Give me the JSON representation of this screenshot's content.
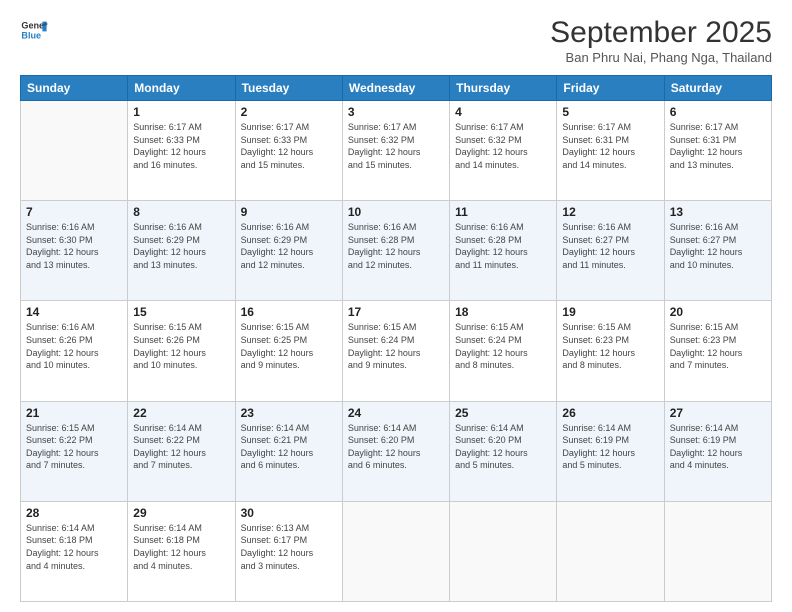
{
  "header": {
    "logo_line1": "General",
    "logo_line2": "Blue",
    "month": "September 2025",
    "location": "Ban Phru Nai, Phang Nga, Thailand"
  },
  "days_of_week": [
    "Sunday",
    "Monday",
    "Tuesday",
    "Wednesday",
    "Thursday",
    "Friday",
    "Saturday"
  ],
  "weeks": [
    [
      {
        "day": "",
        "info": ""
      },
      {
        "day": "1",
        "info": "Sunrise: 6:17 AM\nSunset: 6:33 PM\nDaylight: 12 hours\nand 16 minutes."
      },
      {
        "day": "2",
        "info": "Sunrise: 6:17 AM\nSunset: 6:33 PM\nDaylight: 12 hours\nand 15 minutes."
      },
      {
        "day": "3",
        "info": "Sunrise: 6:17 AM\nSunset: 6:32 PM\nDaylight: 12 hours\nand 15 minutes."
      },
      {
        "day": "4",
        "info": "Sunrise: 6:17 AM\nSunset: 6:32 PM\nDaylight: 12 hours\nand 14 minutes."
      },
      {
        "day": "5",
        "info": "Sunrise: 6:17 AM\nSunset: 6:31 PM\nDaylight: 12 hours\nand 14 minutes."
      },
      {
        "day": "6",
        "info": "Sunrise: 6:17 AM\nSunset: 6:31 PM\nDaylight: 12 hours\nand 13 minutes."
      }
    ],
    [
      {
        "day": "7",
        "info": "Sunrise: 6:16 AM\nSunset: 6:30 PM\nDaylight: 12 hours\nand 13 minutes."
      },
      {
        "day": "8",
        "info": "Sunrise: 6:16 AM\nSunset: 6:29 PM\nDaylight: 12 hours\nand 13 minutes."
      },
      {
        "day": "9",
        "info": "Sunrise: 6:16 AM\nSunset: 6:29 PM\nDaylight: 12 hours\nand 12 minutes."
      },
      {
        "day": "10",
        "info": "Sunrise: 6:16 AM\nSunset: 6:28 PM\nDaylight: 12 hours\nand 12 minutes."
      },
      {
        "day": "11",
        "info": "Sunrise: 6:16 AM\nSunset: 6:28 PM\nDaylight: 12 hours\nand 11 minutes."
      },
      {
        "day": "12",
        "info": "Sunrise: 6:16 AM\nSunset: 6:27 PM\nDaylight: 12 hours\nand 11 minutes."
      },
      {
        "day": "13",
        "info": "Sunrise: 6:16 AM\nSunset: 6:27 PM\nDaylight: 12 hours\nand 10 minutes."
      }
    ],
    [
      {
        "day": "14",
        "info": "Sunrise: 6:16 AM\nSunset: 6:26 PM\nDaylight: 12 hours\nand 10 minutes."
      },
      {
        "day": "15",
        "info": "Sunrise: 6:15 AM\nSunset: 6:26 PM\nDaylight: 12 hours\nand 10 minutes."
      },
      {
        "day": "16",
        "info": "Sunrise: 6:15 AM\nSunset: 6:25 PM\nDaylight: 12 hours\nand 9 minutes."
      },
      {
        "day": "17",
        "info": "Sunrise: 6:15 AM\nSunset: 6:24 PM\nDaylight: 12 hours\nand 9 minutes."
      },
      {
        "day": "18",
        "info": "Sunrise: 6:15 AM\nSunset: 6:24 PM\nDaylight: 12 hours\nand 8 minutes."
      },
      {
        "day": "19",
        "info": "Sunrise: 6:15 AM\nSunset: 6:23 PM\nDaylight: 12 hours\nand 8 minutes."
      },
      {
        "day": "20",
        "info": "Sunrise: 6:15 AM\nSunset: 6:23 PM\nDaylight: 12 hours\nand 7 minutes."
      }
    ],
    [
      {
        "day": "21",
        "info": "Sunrise: 6:15 AM\nSunset: 6:22 PM\nDaylight: 12 hours\nand 7 minutes."
      },
      {
        "day": "22",
        "info": "Sunrise: 6:14 AM\nSunset: 6:22 PM\nDaylight: 12 hours\nand 7 minutes."
      },
      {
        "day": "23",
        "info": "Sunrise: 6:14 AM\nSunset: 6:21 PM\nDaylight: 12 hours\nand 6 minutes."
      },
      {
        "day": "24",
        "info": "Sunrise: 6:14 AM\nSunset: 6:20 PM\nDaylight: 12 hours\nand 6 minutes."
      },
      {
        "day": "25",
        "info": "Sunrise: 6:14 AM\nSunset: 6:20 PM\nDaylight: 12 hours\nand 5 minutes."
      },
      {
        "day": "26",
        "info": "Sunrise: 6:14 AM\nSunset: 6:19 PM\nDaylight: 12 hours\nand 5 minutes."
      },
      {
        "day": "27",
        "info": "Sunrise: 6:14 AM\nSunset: 6:19 PM\nDaylight: 12 hours\nand 4 minutes."
      }
    ],
    [
      {
        "day": "28",
        "info": "Sunrise: 6:14 AM\nSunset: 6:18 PM\nDaylight: 12 hours\nand 4 minutes."
      },
      {
        "day": "29",
        "info": "Sunrise: 6:14 AM\nSunset: 6:18 PM\nDaylight: 12 hours\nand 4 minutes."
      },
      {
        "day": "30",
        "info": "Sunrise: 6:13 AM\nSunset: 6:17 PM\nDaylight: 12 hours\nand 3 minutes."
      },
      {
        "day": "",
        "info": ""
      },
      {
        "day": "",
        "info": ""
      },
      {
        "day": "",
        "info": ""
      },
      {
        "day": "",
        "info": ""
      }
    ]
  ]
}
